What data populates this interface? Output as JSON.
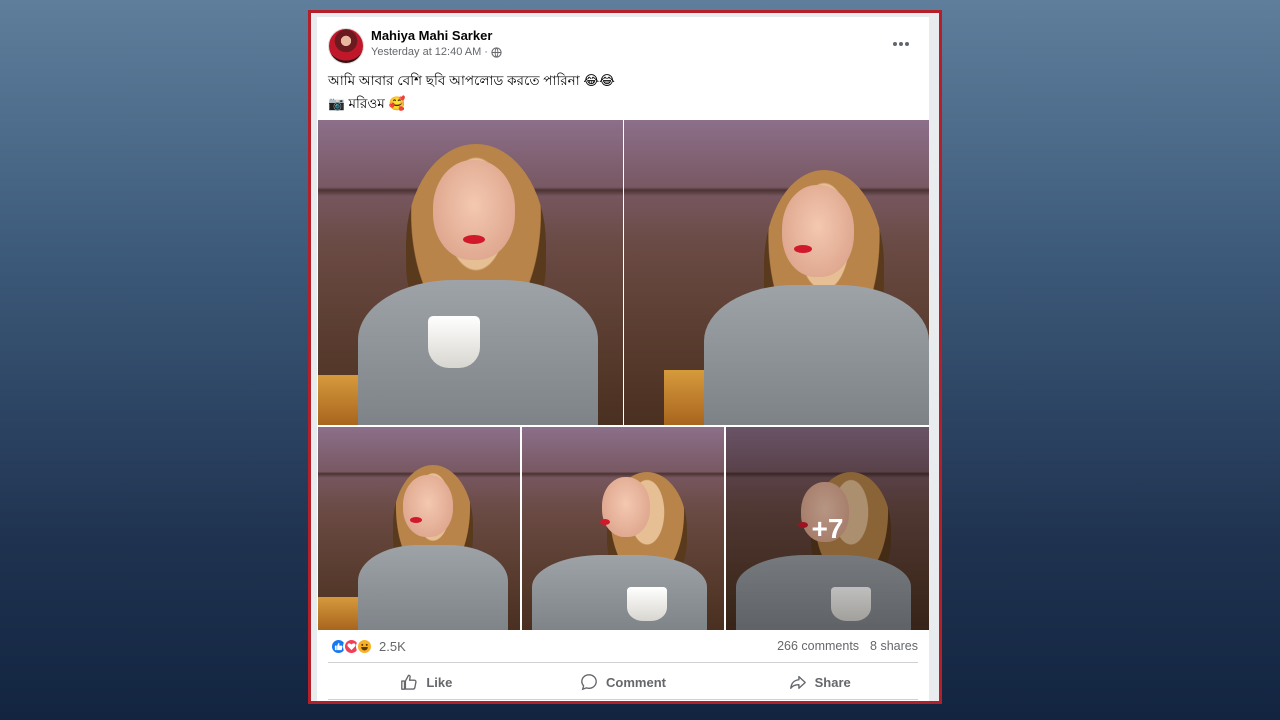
{
  "post": {
    "author": "Mahiya Mahi Sarker",
    "timestamp": "Yesterday at 12:40 AM",
    "separator": "·",
    "caption_line1": "আমি আবার বেশি ছবি আপলোড করতে পারিনা 😂😂",
    "caption_line2": "📷 মরিওম 🥰",
    "more_photos": "+7"
  },
  "engagement": {
    "reaction_count": "2.5K",
    "comments": "266 comments",
    "shares": "8 shares",
    "reactions": [
      "like-icon",
      "love-icon",
      "haha-icon"
    ]
  },
  "actions": {
    "like_label": "Like",
    "comment_label": "Comment",
    "share_label": "Share"
  },
  "colors": {
    "frame_border": "#b3202a",
    "accent": "#1877f2",
    "love": "#f33e58",
    "text_secondary": "#65676b"
  }
}
